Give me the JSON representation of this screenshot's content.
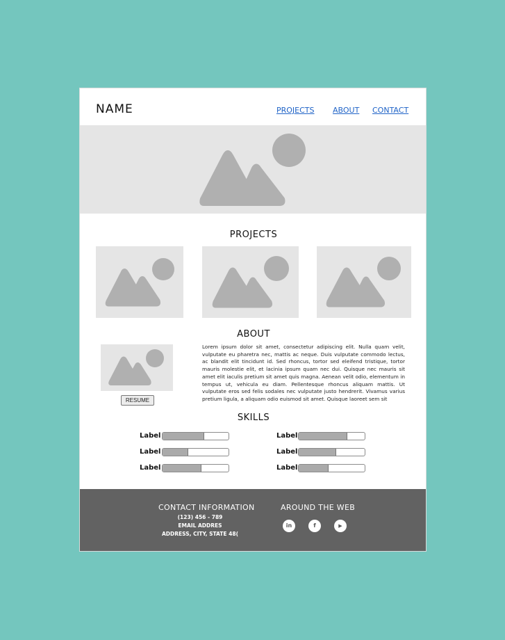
{
  "header": {
    "brand": "NAME",
    "nav": [
      "PROJECTS",
      "ABOUT",
      "CONTACT"
    ]
  },
  "hero": {
    "icon": "image-placeholder-icon"
  },
  "projects": {
    "title": "PROJECTS",
    "items": [
      "image-placeholder-icon",
      "image-placeholder-icon",
      "image-placeholder-icon"
    ]
  },
  "about": {
    "title": "ABOUT",
    "text": "Lorem ipsum dolor sit amet, consectetur adipiscing elit. Nulla quam velit, vulputate eu pharetra nec, mattis ac neque. Duis vulputate commodo lectus, ac blandit elit tincidunt id. Sed rhoncus, tortor sed eleifend tristique, tortor mauris molestie elit, et lacinia ipsum quam nec dui. Quisque nec mauris sit amet elit iaculis pretium sit amet quis magna. Aenean velit odio, elementum in tempus ut, vehicula eu diam. Pellentesque rhoncus aliquam mattis. Ut vulputate eros sed felis sodales nec vulputate justo hendrerit. Vivamus varius pretium ligula, a aliquam odio euismod sit amet. Quisque laoreet sem sit",
    "resume_label": "RESUME"
  },
  "skills": {
    "title": "SKILLS",
    "items": [
      {
        "label": "Label",
        "level": 0.63
      },
      {
        "label": "Label",
        "level": 0.74
      },
      {
        "label": "Label",
        "level": 0.39
      },
      {
        "label": "Label",
        "level": 0.57
      },
      {
        "label": "Label",
        "level": 0.59
      },
      {
        "label": "Label",
        "level": 0.45
      }
    ]
  },
  "footer": {
    "contact_heading": "CONTACT INFORMATION",
    "phone": "(123) 456 - 789",
    "email": "EMAIL ADDRES",
    "address": "ADDRESS, CITY, STATE 48(",
    "web_heading": "AROUND THE WEB",
    "social": [
      {
        "icon": "linkedin-icon",
        "glyph": "in"
      },
      {
        "icon": "facebook-icon",
        "glyph": "f"
      },
      {
        "icon": "youtube-icon",
        "glyph": "▶"
      }
    ]
  },
  "colors": {
    "background": "#74c6be",
    "link": "#1f63c7",
    "placeholder": "#e5e5e5",
    "placeholder_shape": "#b0b0b0",
    "footer": "#626262"
  }
}
